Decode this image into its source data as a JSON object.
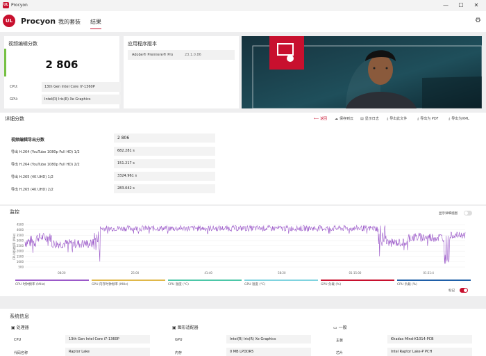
{
  "window": {
    "title": "Procyon",
    "minimize": "—",
    "maximize": "☐",
    "close": "✕"
  },
  "nav": {
    "logo": "UL",
    "brand": "Procyon",
    "tabs": [
      "我的套装",
      "结果"
    ],
    "active_tab": 1
  },
  "score_card": {
    "title": "视频编辑分数",
    "score": "2 806",
    "cpu_label": "CPU:",
    "cpu_value": "13th Gen Intel Core i7-1360P",
    "gpu_label": "GPU:",
    "gpu_value": "Intel(R) Iris(R) Xe Graphics"
  },
  "app_version": {
    "title": "应用程序版本",
    "name": "Adobe® Premiere® Pro",
    "version": "23.1.0.86"
  },
  "details": {
    "title": "详细分数",
    "actions": [
      {
        "icon": "back-arrow-icon",
        "glyph": "⟵",
        "label": "返回",
        "accent": true
      },
      {
        "icon": "cloud-save-icon",
        "glyph": "☁",
        "label": "保存到云"
      },
      {
        "icon": "log-icon",
        "glyph": "▤",
        "label": "显示日志"
      },
      {
        "icon": "export-file-icon",
        "glyph": "⤓",
        "label": "导出此文件"
      },
      {
        "icon": "export-pdf-icon",
        "glyph": "⤓",
        "label": "导出为 PDF"
      },
      {
        "icon": "export-xml-icon",
        "glyph": "⤓",
        "label": "导出为XML"
      }
    ],
    "header_label": "视频编辑导出分数",
    "header_value": "2 806",
    "rows": [
      {
        "label": "导出 H.264 (YouTube 1080p Full HD) 1/2",
        "value": "682.281 s"
      },
      {
        "label": "导出 H.264 (YouTube 1080p Full HD) 2/2",
        "value": "151.217 s"
      },
      {
        "label": "导出 H.265 (4K UHD) 1/2",
        "value": "3324.961 s"
      },
      {
        "label": "导出 H.265 (4K UHD) 2/2",
        "value": "283.042 s"
      }
    ]
  },
  "monitor": {
    "title": "监控",
    "toggle_label": "显示详细视图",
    "marker_label": "标记",
    "y_axis_label": "CPU 时钟频率 (MHz)",
    "accent": "#9b59c9"
  },
  "chart_data": {
    "type": "line",
    "series": [
      {
        "name": "CPU 时钟频率 (MHz)"
      }
    ],
    "y_ticks": [
      "4500",
      "4000",
      "3500",
      "3000",
      "2500",
      "2000",
      "1500",
      "1000",
      "500"
    ],
    "ylim": [
      500,
      4700
    ],
    "x_ticks": [
      "08:20",
      "25:00",
      "41:40",
      "58:20",
      "01:15:00",
      "01:31:4"
    ],
    "profile": [
      {
        "from": 0,
        "to": 0.025,
        "base": 2900,
        "noise": 1200
      },
      {
        "from": 0.025,
        "to": 0.06,
        "base": 3300,
        "noise": 900
      },
      {
        "from": 0.06,
        "to": 0.155,
        "base": 2700,
        "noise": 900
      },
      {
        "from": 0.155,
        "to": 0.17,
        "base": 3000,
        "noise": 2200
      },
      {
        "from": 0.17,
        "to": 0.8,
        "base": 4150,
        "noise": 550
      },
      {
        "from": 0.8,
        "to": 0.82,
        "base": 3500,
        "noise": 2200
      },
      {
        "from": 0.82,
        "to": 0.87,
        "base": 2800,
        "noise": 800
      },
      {
        "from": 0.87,
        "to": 0.95,
        "base": 3300,
        "noise": 900
      },
      {
        "from": 0.95,
        "to": 0.965,
        "base": 2200,
        "noise": 2800
      },
      {
        "from": 0.965,
        "to": 1.0,
        "base": 3500,
        "noise": 600
      }
    ],
    "legend": [
      {
        "label": "CPU 时钟频率 (MHz)",
        "color": "#9b59c9"
      },
      {
        "label": "GPU 内存时钟频率 (MHz)",
        "color": "#e0b84a"
      },
      {
        "label": "CPU 温度 (°C)",
        "color": "#4cc7a8"
      },
      {
        "label": "GPU 温度 (°C)",
        "color": "#7fd3df"
      },
      {
        "label": "GPU 负载 (%)",
        "color": "#c8102e"
      },
      {
        "label": "CPU 负载 (%)",
        "color": "#1f5fa8"
      }
    ]
  },
  "system": {
    "title": "系统信息",
    "groups": [
      {
        "icon": "cpu-icon",
        "title": "处理器",
        "rows": [
          {
            "label": "CPU",
            "value": "13th Gen Intel Core i7-1360P"
          },
          {
            "label": "代码名称",
            "value": "Raptor Lake"
          }
        ]
      },
      {
        "icon": "gpu-icon",
        "title": "图形适配器",
        "rows": [
          {
            "label": "GPU",
            "value": "Intel(R) Iris(R) Xe Graphics"
          },
          {
            "label": "内存",
            "value": "0 MB LPDDR5"
          }
        ]
      },
      {
        "icon": "general-icon",
        "title": "一般",
        "rows": [
          {
            "label": "主板",
            "value": "Khadas Mind-K1014-PCB"
          },
          {
            "label": "芯片",
            "value": "Intel Raptor Lake-P PCH"
          }
        ]
      }
    ]
  }
}
